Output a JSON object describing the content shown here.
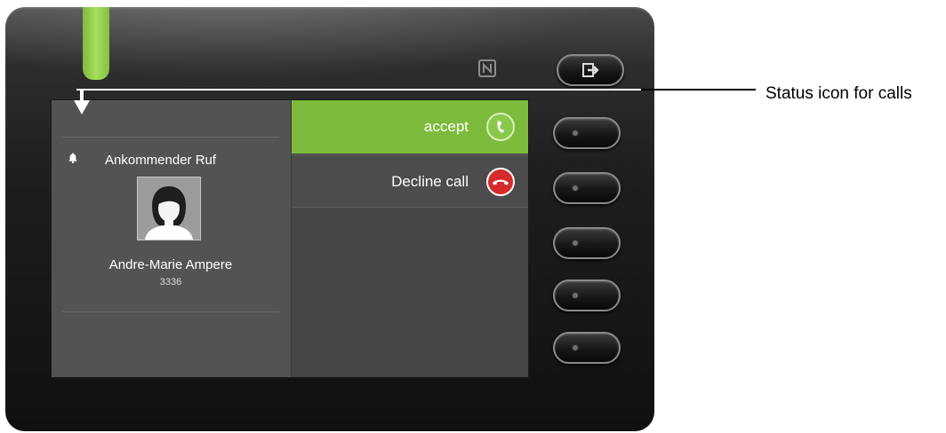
{
  "device": {
    "led_color": "#9dd554",
    "icons": {
      "nfc": "nfc-icon",
      "exit": "exit-icon"
    }
  },
  "call": {
    "status_icon": "bell-icon",
    "state_label": "Ankommender Ruf",
    "avatar": "person-avatar-icon",
    "caller_name": "Andre-Marie Ampere",
    "caller_number": "3336"
  },
  "menu": {
    "items": [
      {
        "label": "accept",
        "icon": "phone-accept-icon",
        "color": "#7cbb3c",
        "selected": true
      },
      {
        "label": "Decline call",
        "icon": "phone-decline-icon",
        "color": "#d52b2b",
        "selected": false
      }
    ]
  },
  "callout": {
    "text": "Status icon for calls"
  }
}
